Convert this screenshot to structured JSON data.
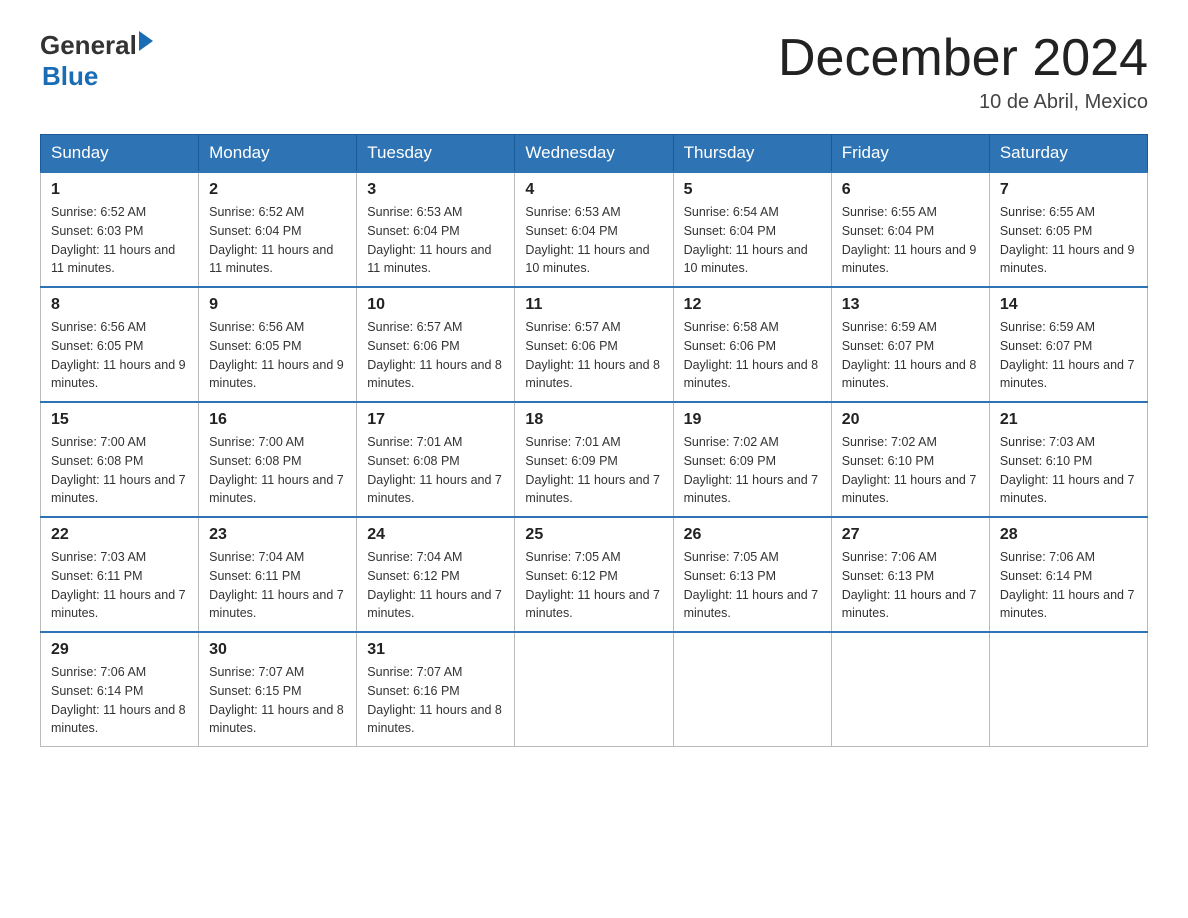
{
  "header": {
    "logo": {
      "general": "General",
      "blue": "Blue"
    },
    "title": "December 2024",
    "subtitle": "10 de Abril, Mexico"
  },
  "weekdays": [
    "Sunday",
    "Monday",
    "Tuesday",
    "Wednesday",
    "Thursday",
    "Friday",
    "Saturday"
  ],
  "weeks": [
    [
      {
        "day": "1",
        "sunrise": "6:52 AM",
        "sunset": "6:03 PM",
        "daylight": "11 hours and 11 minutes."
      },
      {
        "day": "2",
        "sunrise": "6:52 AM",
        "sunset": "6:04 PM",
        "daylight": "11 hours and 11 minutes."
      },
      {
        "day": "3",
        "sunrise": "6:53 AM",
        "sunset": "6:04 PM",
        "daylight": "11 hours and 11 minutes."
      },
      {
        "day": "4",
        "sunrise": "6:53 AM",
        "sunset": "6:04 PM",
        "daylight": "11 hours and 10 minutes."
      },
      {
        "day": "5",
        "sunrise": "6:54 AM",
        "sunset": "6:04 PM",
        "daylight": "11 hours and 10 minutes."
      },
      {
        "day": "6",
        "sunrise": "6:55 AM",
        "sunset": "6:04 PM",
        "daylight": "11 hours and 9 minutes."
      },
      {
        "day": "7",
        "sunrise": "6:55 AM",
        "sunset": "6:05 PM",
        "daylight": "11 hours and 9 minutes."
      }
    ],
    [
      {
        "day": "8",
        "sunrise": "6:56 AM",
        "sunset": "6:05 PM",
        "daylight": "11 hours and 9 minutes."
      },
      {
        "day": "9",
        "sunrise": "6:56 AM",
        "sunset": "6:05 PM",
        "daylight": "11 hours and 9 minutes."
      },
      {
        "day": "10",
        "sunrise": "6:57 AM",
        "sunset": "6:06 PM",
        "daylight": "11 hours and 8 minutes."
      },
      {
        "day": "11",
        "sunrise": "6:57 AM",
        "sunset": "6:06 PM",
        "daylight": "11 hours and 8 minutes."
      },
      {
        "day": "12",
        "sunrise": "6:58 AM",
        "sunset": "6:06 PM",
        "daylight": "11 hours and 8 minutes."
      },
      {
        "day": "13",
        "sunrise": "6:59 AM",
        "sunset": "6:07 PM",
        "daylight": "11 hours and 8 minutes."
      },
      {
        "day": "14",
        "sunrise": "6:59 AM",
        "sunset": "6:07 PM",
        "daylight": "11 hours and 7 minutes."
      }
    ],
    [
      {
        "day": "15",
        "sunrise": "7:00 AM",
        "sunset": "6:08 PM",
        "daylight": "11 hours and 7 minutes."
      },
      {
        "day": "16",
        "sunrise": "7:00 AM",
        "sunset": "6:08 PM",
        "daylight": "11 hours and 7 minutes."
      },
      {
        "day": "17",
        "sunrise": "7:01 AM",
        "sunset": "6:08 PM",
        "daylight": "11 hours and 7 minutes."
      },
      {
        "day": "18",
        "sunrise": "7:01 AM",
        "sunset": "6:09 PM",
        "daylight": "11 hours and 7 minutes."
      },
      {
        "day": "19",
        "sunrise": "7:02 AM",
        "sunset": "6:09 PM",
        "daylight": "11 hours and 7 minutes."
      },
      {
        "day": "20",
        "sunrise": "7:02 AM",
        "sunset": "6:10 PM",
        "daylight": "11 hours and 7 minutes."
      },
      {
        "day": "21",
        "sunrise": "7:03 AM",
        "sunset": "6:10 PM",
        "daylight": "11 hours and 7 minutes."
      }
    ],
    [
      {
        "day": "22",
        "sunrise": "7:03 AM",
        "sunset": "6:11 PM",
        "daylight": "11 hours and 7 minutes."
      },
      {
        "day": "23",
        "sunrise": "7:04 AM",
        "sunset": "6:11 PM",
        "daylight": "11 hours and 7 minutes."
      },
      {
        "day": "24",
        "sunrise": "7:04 AM",
        "sunset": "6:12 PM",
        "daylight": "11 hours and 7 minutes."
      },
      {
        "day": "25",
        "sunrise": "7:05 AM",
        "sunset": "6:12 PM",
        "daylight": "11 hours and 7 minutes."
      },
      {
        "day": "26",
        "sunrise": "7:05 AM",
        "sunset": "6:13 PM",
        "daylight": "11 hours and 7 minutes."
      },
      {
        "day": "27",
        "sunrise": "7:06 AM",
        "sunset": "6:13 PM",
        "daylight": "11 hours and 7 minutes."
      },
      {
        "day": "28",
        "sunrise": "7:06 AM",
        "sunset": "6:14 PM",
        "daylight": "11 hours and 7 minutes."
      }
    ],
    [
      {
        "day": "29",
        "sunrise": "7:06 AM",
        "sunset": "6:14 PM",
        "daylight": "11 hours and 8 minutes."
      },
      {
        "day": "30",
        "sunrise": "7:07 AM",
        "sunset": "6:15 PM",
        "daylight": "11 hours and 8 minutes."
      },
      {
        "day": "31",
        "sunrise": "7:07 AM",
        "sunset": "6:16 PM",
        "daylight": "11 hours and 8 minutes."
      },
      null,
      null,
      null,
      null
    ]
  ]
}
